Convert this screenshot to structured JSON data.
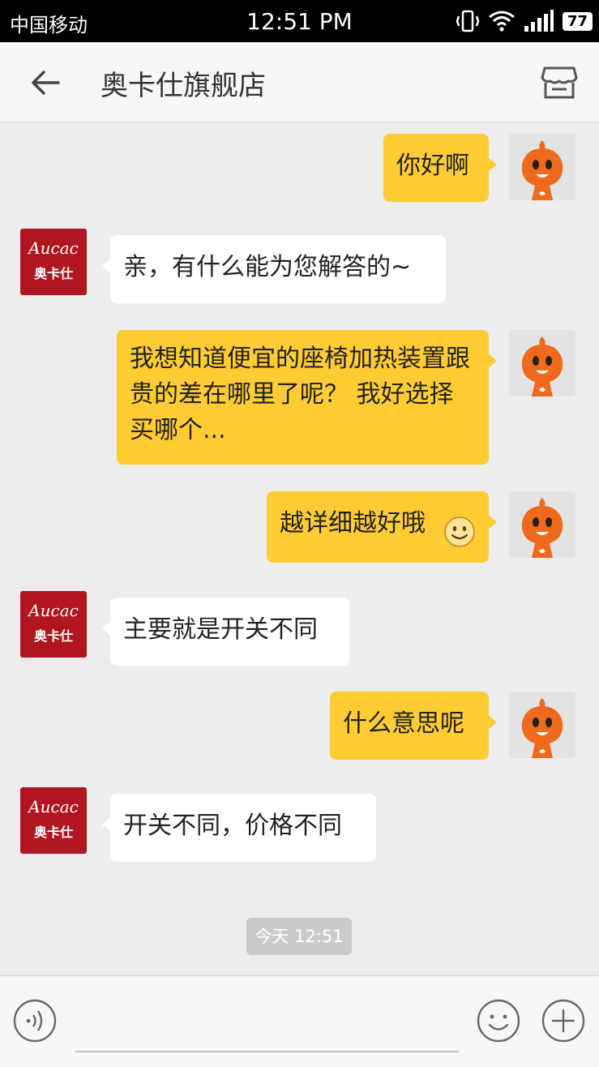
{
  "status": {
    "carrier": "中国移动",
    "time": "12:51 PM",
    "battery": "77"
  },
  "nav": {
    "title": "奥卡仕旗舰店"
  },
  "brand_avatar": {
    "script": "Aucac",
    "name": "奥卡仕"
  },
  "messages": [
    {
      "side": "right",
      "text": "你好啊"
    },
    {
      "side": "left",
      "text": "亲，有什么能为您解答的~"
    },
    {
      "side": "right",
      "text": "我想知道便宜的座椅加热装置跟贵的差在哪里了呢？ 我好选择买哪个..."
    },
    {
      "side": "right",
      "text": "越详细越好哦"
    },
    {
      "side": "left",
      "text": "主要就是开关不同"
    },
    {
      "side": "right",
      "text": "什么意思呢"
    },
    {
      "side": "left",
      "text": "开关不同，价格不同"
    }
  ],
  "timestamp": "今天 12:51",
  "colors": {
    "bubble_self": "#ffcc33",
    "bubble_other": "#ffffff",
    "brand": "#b0161f",
    "avatar_orange": "#f06a1d"
  }
}
